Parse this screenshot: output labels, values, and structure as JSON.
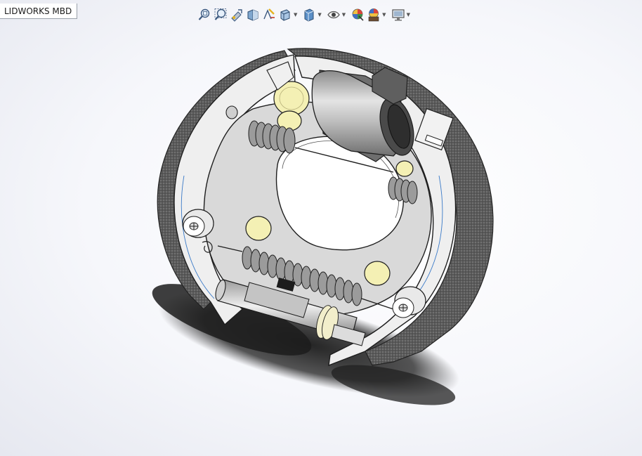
{
  "tab": {
    "label": "LIDWORKS MBD"
  },
  "hud_toolbar": {
    "items": [
      {
        "icon": "zoom-to-fit-icon"
      },
      {
        "icon": "zoom-to-area-icon"
      },
      {
        "icon": "previous-view-icon"
      },
      {
        "icon": "section-view-icon"
      },
      {
        "icon": "dynamic-annotation-view-icon"
      },
      {
        "icon": "view-orientation-icon",
        "dropdown": true
      },
      {
        "icon": "display-style-icon",
        "dropdown": true
      },
      {
        "icon": "hide-show-items-icon",
        "dropdown": true
      },
      {
        "icon": "edit-appearance-icon"
      },
      {
        "icon": "apply-scene-icon",
        "dropdown": true
      },
      {
        "icon": "view-setting-icon",
        "dropdown": true
      }
    ],
    "caret_glyph": "▼"
  },
  "model": {
    "description_icon": "brake-drum-assembly-icon",
    "colors": {
      "lining": "#4a4a4a",
      "shoe": "#eeeeee",
      "backplate": "#d8d8d8",
      "cylinder": "#b0b0b0",
      "rivet": "#f3efb0",
      "shadow": "#222222"
    }
  }
}
